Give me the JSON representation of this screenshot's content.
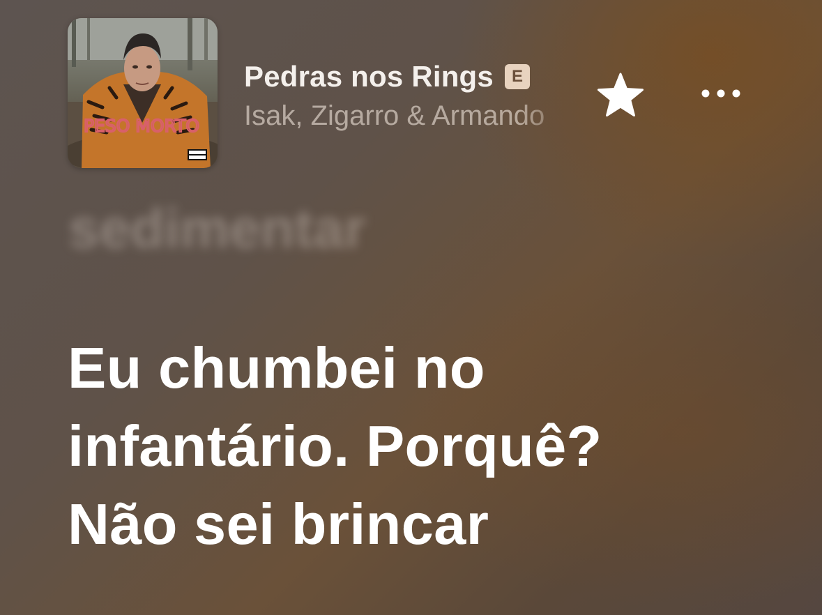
{
  "now_playing": {
    "artwork": {
      "label": "PESO MORTO",
      "parental_advisory": "PARENTAL ADVISORY EXPLICIT CONTENT"
    },
    "title": "Pedras nos Rings",
    "explicit_badge": "E",
    "artists": "Isak, Zigarro & Armando",
    "favorite_icon": "star-icon",
    "more_icon": "ellipsis-icon"
  },
  "lyrics": {
    "previous_line": "sedimentar",
    "current_lines": [
      "Eu chumbei no",
      "infantário. Porquê?",
      "Não sei brincar"
    ]
  },
  "colors": {
    "explicit_badge_bg": "#e8d3bf",
    "lyric_active": "#ffffff",
    "background_warm": "#6a5139"
  }
}
